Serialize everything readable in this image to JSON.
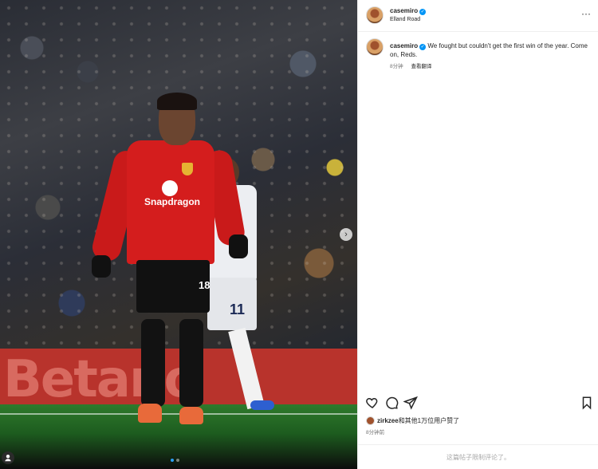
{
  "post": {
    "username": "casemiro",
    "location": "Elland Road",
    "more_label": "···",
    "caption_text": "We fought but couldn't get the first win of the year. Come on, Reds.",
    "caption_time": "8分钟",
    "translate_label": "查看翻译",
    "likes_user": "zirkzee",
    "likes_text": "和其他1万位用户赞了",
    "post_time": "8分钟前",
    "comments_restricted": "这篇帖子限制评论了。"
  },
  "media": {
    "hoarding_text": "Betano",
    "sponsor_text": "Snapdragon",
    "player_number": "18",
    "opponent_number": "11",
    "carousel_total": 2,
    "carousel_active": 1
  },
  "icons": [
    "verified-icon",
    "more-icon",
    "heart-icon",
    "comment-icon",
    "share-icon",
    "bookmark-icon",
    "carousel-next-icon",
    "tag-user-icon"
  ],
  "colors": {
    "verified": "#0095f6",
    "kit_red": "#d41d1d",
    "secondary_text": "#737373"
  }
}
